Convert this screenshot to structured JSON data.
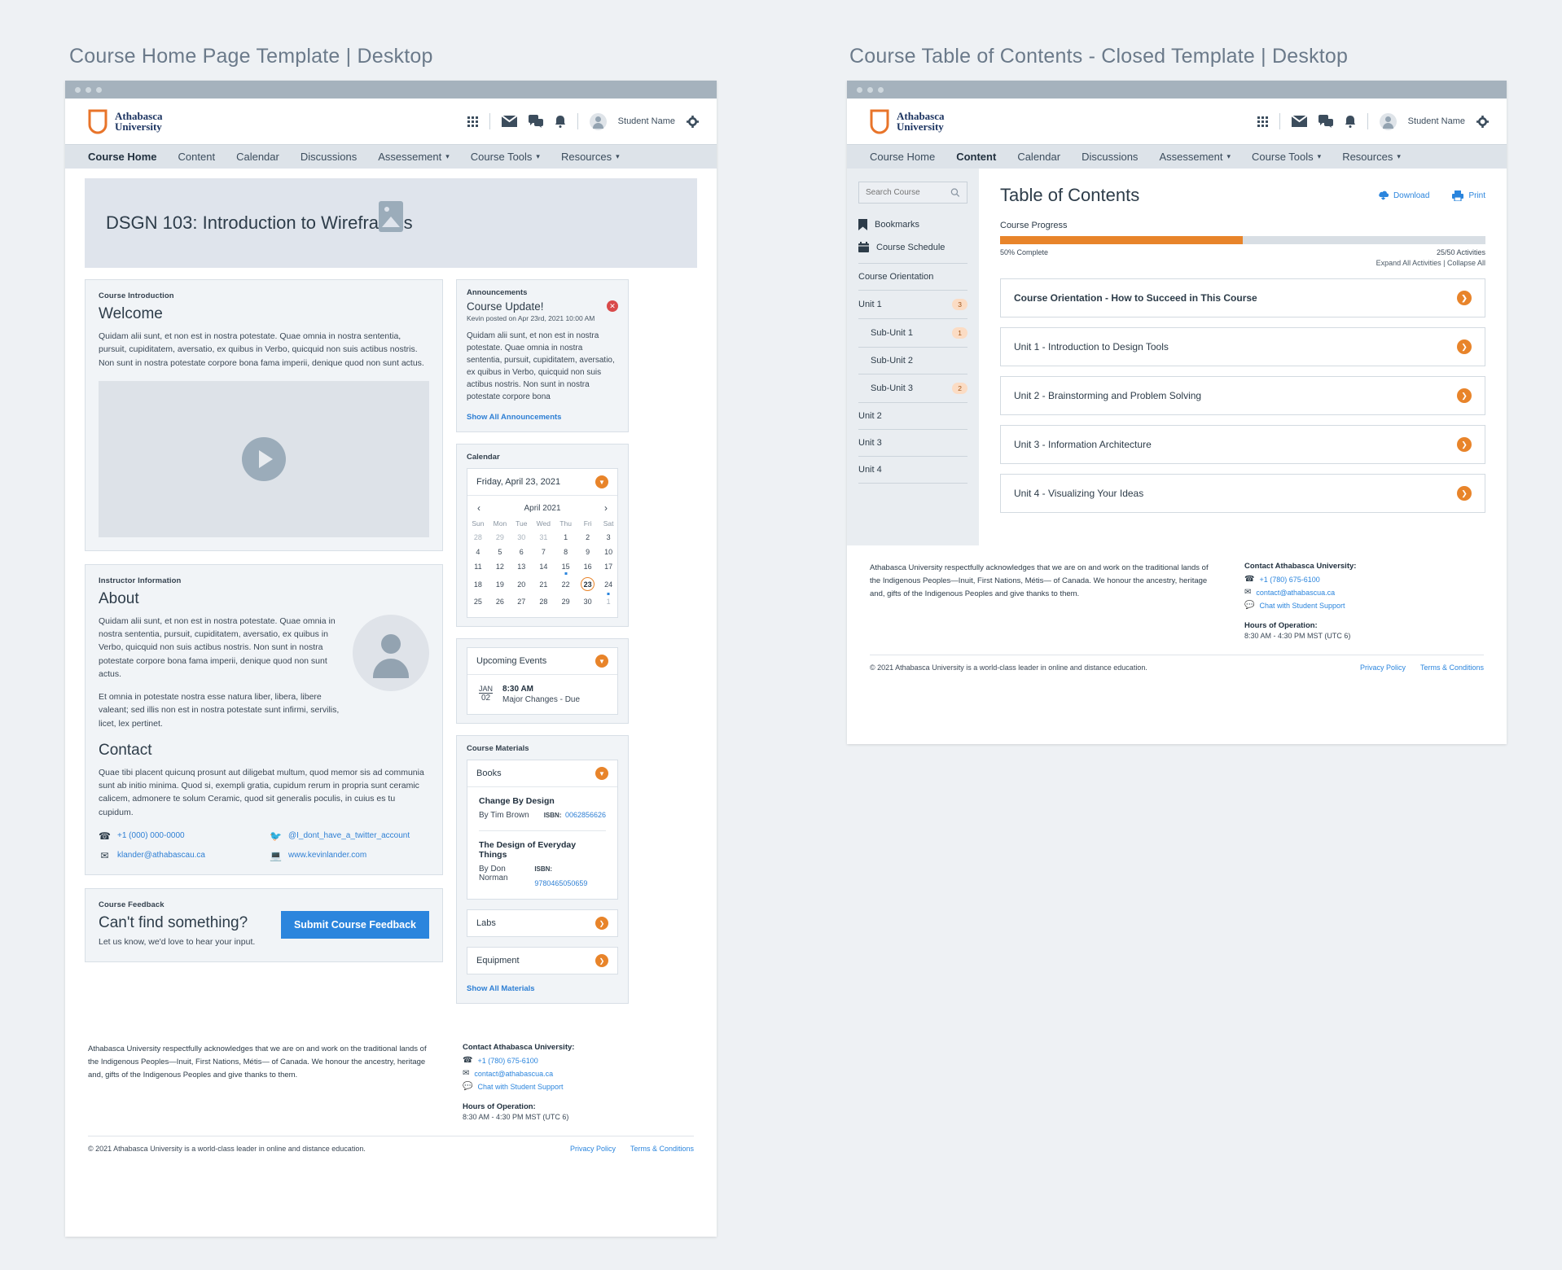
{
  "left_panel": {
    "title": "Course Home Page Template | Desktop",
    "header": {
      "logo_line1": "Athabasca",
      "logo_line2": "University",
      "student_name": "Student Name"
    },
    "nav": [
      {
        "label": "Course Home",
        "active": true,
        "caret": false
      },
      {
        "label": "Content",
        "active": false,
        "caret": false
      },
      {
        "label": "Calendar",
        "active": false,
        "caret": false
      },
      {
        "label": "Discussions",
        "active": false,
        "caret": false
      },
      {
        "label": "Assessement",
        "active": false,
        "caret": true
      },
      {
        "label": "Course Tools",
        "active": false,
        "caret": true
      },
      {
        "label": "Resources",
        "active": false,
        "caret": true
      }
    ],
    "hero": {
      "course_title": "DSGN 103: Introduction to Wireframes"
    },
    "intro": {
      "eyebrow": "Course Introduction",
      "heading": "Welcome",
      "body": "Quidam alii sunt, et non est in nostra potestate. Quae omnia in nostra sententia, pursuit, cupiditatem, aversatio, ex quibus in Verbo, quicquid non suis actibus nostris. Non sunt in nostra potestate corpore bona fama imperii, denique quod non sunt actus."
    },
    "instructor": {
      "eyebrow": "Instructor Information",
      "heading": "About",
      "para1": "Quidam alii sunt, et non est in nostra potestate. Quae omnia in nostra sententia, pursuit, cupiditatem, aversatio, ex quibus in Verbo, quicquid non suis actibus nostris. Non sunt in nostra potestate corpore bona fama imperii, denique quod non sunt actus.",
      "para2": "Et omnia in potestate nostra esse natura liber, libera, libere valeant; sed illis non est in nostra potestate sunt infirmi, servilis, licet, lex pertinet.",
      "contact_heading": "Contact",
      "contact_body": "Quae tibi placent quicunq prosunt aut diligebat multum, quod memor sis ad communia sunt ab initio minima. Quod si, exempli gratia, cupidum rerum in propria sunt ceramic calicem, admonere te solum Ceramic, quod sit generalis poculis, in cuius es tu cupidum.",
      "phone": "+1 (000) 000-0000",
      "email": "klander@athabascau.ca",
      "twitter": "@I_dont_have_a_twitter_account",
      "website": "www.kevinlander.com"
    },
    "feedback": {
      "eyebrow": "Course Feedback",
      "heading": "Can't find something?",
      "sub": "Let us know, we'd love to hear your input.",
      "button": "Submit Course Feedback"
    },
    "announcements": {
      "title": "Announcements",
      "headline": "Course Update!",
      "meta": "Kevin posted on Apr 23rd, 2021 10:00 AM",
      "body": "Quidam alii sunt, et non est in nostra potestate. Quae omnia in nostra sententia, pursuit, cupiditatem, aversatio, ex quibus in Verbo, quicquid non suis actibus nostris. Non sunt in nostra potestate corpore bona",
      "show_all": "Show All Announcements"
    },
    "calendar": {
      "title": "Calendar",
      "selected_date": "Friday, April 23, 2021",
      "month_label": "April 2021",
      "weekdays": [
        "Sun",
        "Mon",
        "Tue",
        "Wed",
        "Thu",
        "Fri",
        "Sat"
      ],
      "weeks": [
        [
          {
            "d": "28",
            "m": true
          },
          {
            "d": "29",
            "m": true
          },
          {
            "d": "30",
            "m": true
          },
          {
            "d": "31",
            "m": true
          },
          {
            "d": "1"
          },
          {
            "d": "2"
          },
          {
            "d": "3"
          }
        ],
        [
          {
            "d": "4"
          },
          {
            "d": "5"
          },
          {
            "d": "6"
          },
          {
            "d": "7"
          },
          {
            "d": "8"
          },
          {
            "d": "9"
          },
          {
            "d": "10"
          }
        ],
        [
          {
            "d": "11"
          },
          {
            "d": "12"
          },
          {
            "d": "13"
          },
          {
            "d": "14"
          },
          {
            "d": "15",
            "dot": true
          },
          {
            "d": "16"
          },
          {
            "d": "17"
          }
        ],
        [
          {
            "d": "18"
          },
          {
            "d": "19"
          },
          {
            "d": "20"
          },
          {
            "d": "21"
          },
          {
            "d": "22"
          },
          {
            "d": "23",
            "today": true
          },
          {
            "d": "24",
            "dot": true
          }
        ],
        [
          {
            "d": "25"
          },
          {
            "d": "26"
          },
          {
            "d": "27"
          },
          {
            "d": "28"
          },
          {
            "d": "29"
          },
          {
            "d": "30"
          },
          {
            "d": "1",
            "m": true
          }
        ]
      ]
    },
    "events": {
      "title": "Upcoming Events",
      "items": [
        {
          "month": "JAN",
          "day": "02",
          "time": "8:30 AM",
          "name": "Major Changes - Due"
        }
      ]
    },
    "materials": {
      "title": "Course Materials",
      "books_label": "Books",
      "books": [
        {
          "title": "Change By Design",
          "author": "By Tim Brown",
          "isbn_label": "ISBN:",
          "isbn": "0062856626"
        },
        {
          "title": "The Design of Everyday Things",
          "author": "By Don Norman",
          "isbn_label": "ISBN:",
          "isbn": "9780465050659"
        }
      ],
      "labs_label": "Labs",
      "equipment_label": "Equipment",
      "show_all": "Show All Materials"
    }
  },
  "right_panel": {
    "title": "Course Table of Contents -  Closed Template | Desktop",
    "nav": [
      {
        "label": "Course Home",
        "active": false,
        "caret": false
      },
      {
        "label": "Content",
        "active": true,
        "caret": false
      },
      {
        "label": "Calendar",
        "active": false,
        "caret": false
      },
      {
        "label": "Discussions",
        "active": false,
        "caret": false
      },
      {
        "label": "Assessement",
        "active": false,
        "caret": true
      },
      {
        "label": "Course Tools",
        "active": false,
        "caret": true
      },
      {
        "label": "Resources",
        "active": false,
        "caret": true
      }
    ],
    "sidebar": {
      "search_placeholder": "Search Course",
      "search_value": "",
      "links": [
        {
          "label": "Bookmarks",
          "icon": "bookmark-icon"
        },
        {
          "label": "Course Schedule",
          "icon": "calendar-icon"
        }
      ],
      "units": [
        {
          "label": "Course Orientation",
          "badge": "",
          "sub": false
        },
        {
          "label": "Unit 1",
          "badge": "3",
          "sub": false
        },
        {
          "label": "Sub-Unit 1",
          "badge": "1",
          "sub": true
        },
        {
          "label": "Sub-Unit 2",
          "badge": "",
          "sub": true
        },
        {
          "label": "Sub-Unit 3",
          "badge": "2",
          "sub": true
        },
        {
          "label": "Unit 2",
          "badge": "",
          "sub": false
        },
        {
          "label": "Unit 3",
          "badge": "",
          "sub": false
        },
        {
          "label": "Unit 4",
          "badge": "",
          "sub": false
        }
      ]
    },
    "toc": {
      "heading": "Table of Contents",
      "download_label": "Download",
      "print_label": "Print",
      "progress_label": "Course Progress",
      "progress_percent": 50,
      "percent_text": "50% Complete",
      "activities_text": "25/50 Activities",
      "expand_text": "Expand All Activities | Collapse All",
      "items": [
        "Course Orientation - How to Succeed in This Course",
        "Unit 1 - Introduction to Design Tools",
        "Unit 2 - Brainstorming and Problem Solving",
        "Unit 3 - Information Architecture",
        "Unit 4 - Visualizing Your Ideas"
      ]
    }
  },
  "footer": {
    "acknowledgement": "Athabasca University respectfully acknowledges that we are on and work on the traditional lands of the Indigenous Peoples—Inuit, First Nations, Métis— of Canada. We honour the ancestry, heritage and, gifts of the Indigenous Peoples and give thanks to them.",
    "contact_heading": "Contact Athabasca University:",
    "phone": "+1 (780) 675-6100",
    "email": "contact@athabascua.ca",
    "chat": "Chat with Student Support",
    "hours_heading": "Hours of Operation:",
    "hours": "8:30 AM - 4:30 PM MST (UTC 6)",
    "copyright": "© 2021 Athabasca University is a world-class leader in online and distance education.",
    "privacy": "Privacy Policy",
    "terms": "Terms & Conditions"
  },
  "colors": {
    "orange": "#e8842a",
    "blue": "#2b85dd",
    "navy": "#2d3c49",
    "chrome": "#a5b2bd"
  }
}
